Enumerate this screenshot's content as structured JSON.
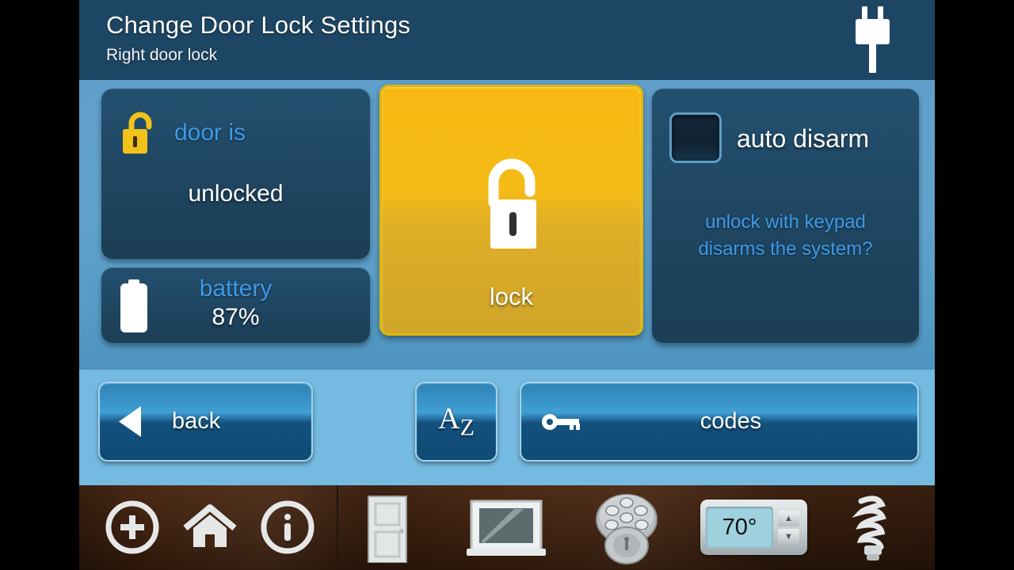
{
  "header": {
    "title": "Change Door Lock Settings",
    "subtitle": "Right door lock",
    "plug_icon": "power-plug-icon"
  },
  "colors": {
    "header_bg": "#1d4664",
    "panel_bg": "#5f9fc9",
    "card_bg": "#1f4560",
    "button_bar_bg": "#75bae1",
    "accent_blue": "#3d9ae8",
    "lock_button_gold": "#f5bb16",
    "toolbar_wood": "#3d2110"
  },
  "status_card": {
    "icon": "unlocked-padlock-icon",
    "label": "door is",
    "value": "unlocked"
  },
  "battery_card": {
    "icon": "battery-icon",
    "label": "battery",
    "value": "87%"
  },
  "lock_action": {
    "icon": "open-padlock-icon",
    "caption": "lock"
  },
  "auto_disarm": {
    "checkbox_state": "unchecked",
    "label": "auto disarm",
    "hint_line1": "unlock with keypad",
    "hint_line2": "disarms the system?"
  },
  "buttons": {
    "back": {
      "label": "back",
      "icon": "left-arrow-icon"
    },
    "rename": {
      "label": "A Z",
      "letter_main": "A",
      "letter_sub": "Z",
      "icon": "alphabetize-icon"
    },
    "codes": {
      "label": "codes",
      "icon": "key-icon"
    }
  },
  "toolbar": {
    "items": [
      {
        "name": "add-button",
        "icon": "plus-circle-icon"
      },
      {
        "name": "home-button",
        "icon": "home-icon"
      },
      {
        "name": "info-button",
        "icon": "info-circle-icon"
      },
      {
        "name": "doors-button",
        "icon": "door-icon"
      },
      {
        "name": "windows-button",
        "icon": "window-icon"
      },
      {
        "name": "locks-button",
        "icon": "deadbolt-keypad-icon"
      },
      {
        "name": "thermostat-button",
        "icon": "thermostat-icon",
        "temperature": "70°",
        "up": "▲",
        "down": "▼"
      },
      {
        "name": "lights-button",
        "icon": "cfl-bulb-icon"
      }
    ]
  }
}
